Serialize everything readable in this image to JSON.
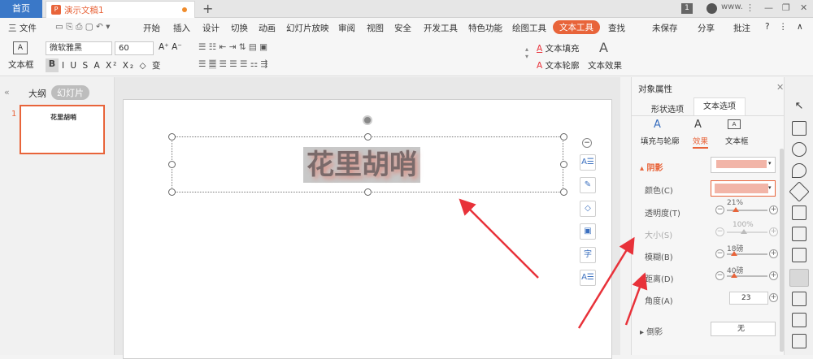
{
  "titlebar": {
    "home_tab": "首页",
    "doc_tab": "演示文稿1",
    "new_tab": "+",
    "page_num": "1",
    "user": "www."
  },
  "menu": [
    "三 文件",
    "开始",
    "插入",
    "设计",
    "切换",
    "动画",
    "幻灯片放映",
    "审阅",
    "视图",
    "安全",
    "开发工具",
    "特色功能",
    "绘图工具",
    "文本工具",
    "查找"
  ],
  "menu_right": {
    "unsaved": "未保存",
    "share": "分享",
    "comment": "批注"
  },
  "ribbon": {
    "textbox": "文本框",
    "font": "微软雅黑",
    "size": "60",
    "text_fill": "文本填充",
    "text_outline": "文本轮廓",
    "text_effect": "文本效果",
    "style_letter": "A"
  },
  "leftpane": {
    "outline": "大纲",
    "slides": "幻灯片",
    "thumb_num": "1",
    "thumb_text": "花里胡哨"
  },
  "slide": {
    "text": "花里胡哨"
  },
  "rightpane": {
    "title": "对象属性",
    "tab_shape": "形状选项",
    "tab_text": "文本选项",
    "sub_fill": "填充与轮廓",
    "sub_effect": "效果",
    "sub_textbox": "文本框",
    "shadow": "阴影",
    "color": "颜色(C)",
    "transparency": "透明度(T)",
    "transparency_val": "21%",
    "size": "大小(S)",
    "size_val": "100%",
    "blur": "模糊(B)",
    "blur_val": "18磅",
    "distance": "距离(D)",
    "distance_val": "40磅",
    "angle": "角度(A)",
    "angle_val": "23",
    "reflection": "倒影",
    "reflection_val": "无"
  },
  "colors": {
    "accent": "#e8643a",
    "shadow_swatch": "#f2b5a8",
    "blue": "#3a78c8",
    "arrow": "#e8323a"
  }
}
